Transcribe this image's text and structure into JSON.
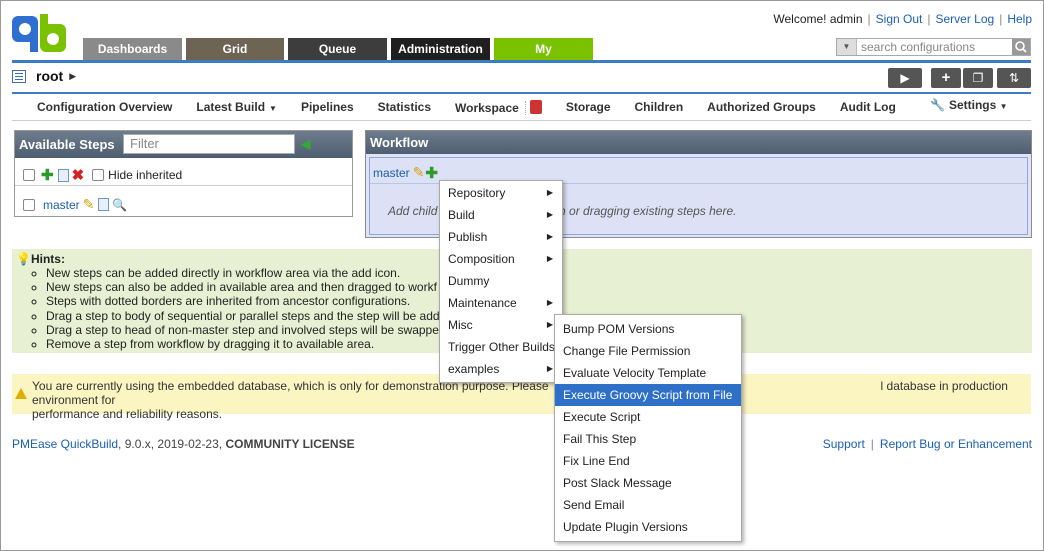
{
  "header": {
    "welcome": "Welcome! admin",
    "sign_out": "Sign Out",
    "server_log": "Server Log",
    "help": "Help",
    "search_placeholder": "search configurations"
  },
  "topnav": {
    "tabs": [
      "Dashboards",
      "Grid",
      "Queue",
      "Administration",
      "My"
    ]
  },
  "root": {
    "title": "root"
  },
  "subnav": {
    "items": [
      "Configuration Overview",
      "Latest Build",
      "Pipelines",
      "Statistics",
      "Workspace",
      "Storage",
      "Children",
      "Authorized Groups",
      "Audit Log"
    ],
    "settings": "Settings"
  },
  "available_steps": {
    "title": "Available Steps",
    "filter_placeholder": "Filter",
    "hide_inherited": "Hide inherited",
    "step": "master"
  },
  "workflow": {
    "title": "Workflow",
    "step": "master",
    "hint": "Add child"
  },
  "hints": {
    "title": "Hints:",
    "items": [
      "New steps can be added directly in workflow area via the add icon.",
      "New steps can also be added in available area and then dragged to workf",
      "Steps with dotted borders are inherited from ancestor configurations.",
      "Drag a step to body of sequential or parallel steps and the step will be add",
      "Drag a step to head of non-master step and involved steps will be swappe",
      "Remove a step from workflow by dragging it to available area."
    ]
  },
  "warning": {
    "line1_a": "You are currently using the embedded database, which is only for demonstration purpose. Please",
    "line1_b": "l database in production environment for",
    "line2": "performance and reliability reasons."
  },
  "footer": {
    "brand": "PMEase QuickBuild",
    "version": ", 9.0.x, 2019-02-23, ",
    "license": "COMMUNITY LICENSE",
    "support": "Support",
    "report": "Report Bug or Enhancement"
  },
  "menu": {
    "items": [
      "Repository",
      "Build",
      "Publish",
      "Composition",
      "Dummy",
      "Maintenance",
      "Misc",
      "Trigger Other Builds",
      "examples"
    ]
  },
  "submenu": {
    "items": [
      "Bump POM Versions",
      "Change File Permission",
      "Evaluate Velocity Template",
      "Execute Groovy Script from File",
      "Execute Script",
      "Fail This Step",
      "Fix Line End",
      "Post Slack Message",
      "Send Email",
      "Update Plugin Versions"
    ],
    "selected": "Execute Groovy Script from File"
  },
  "colors": {
    "accent_blue": "#3b7dc4",
    "my_tab": "#7ac100",
    "selection": "#2e6fc7"
  }
}
